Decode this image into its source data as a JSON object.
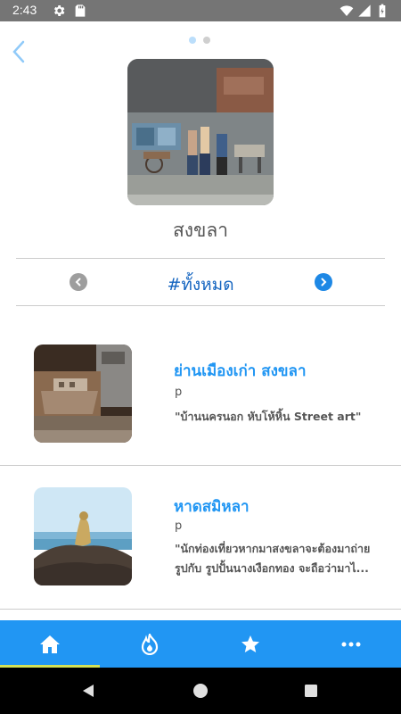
{
  "status_bar": {
    "time": "2:43",
    "icons": [
      "gear-icon",
      "sd-card-icon",
      "wifi-icon",
      "signal-icon",
      "battery-icon"
    ]
  },
  "header": {
    "back_icon": "chevron-left-icon",
    "pager": {
      "pages": 2,
      "active_index": 0
    },
    "title": "สงขลา"
  },
  "filter": {
    "label": "#ทั้งหมด",
    "prev_icon": "chevron-left-circle-icon",
    "next_icon": "chevron-right-circle-icon"
  },
  "places": [
    {
      "title": "ย่านเมืองเก่า สงขลา",
      "subtitle": "p",
      "description_lines": [
        "\"บ้านนครนอก หับโห้หิ้น  Street art\""
      ]
    },
    {
      "title": "หาดสมิหลา",
      "subtitle": "p",
      "description_lines": [
        "\"นักท่องเที่ยวหากมาสงขลาจะต้องมาถ่าย",
        "รูปกับ รูปปั้นนางเงือกทอง จะถือว่ามาไ..."
      ]
    }
  ],
  "bottom_nav": {
    "items": [
      "home-icon",
      "fire-icon",
      "star-icon",
      "more-icon"
    ],
    "active_index": 0
  },
  "system_nav": [
    "back-triangle-icon",
    "home-circle-icon",
    "recents-square-icon"
  ],
  "colors": {
    "accent": "#2196f3",
    "filter_text": "#1565c0",
    "status_bar": "#757575",
    "nav_indicator": "#d4e157"
  }
}
